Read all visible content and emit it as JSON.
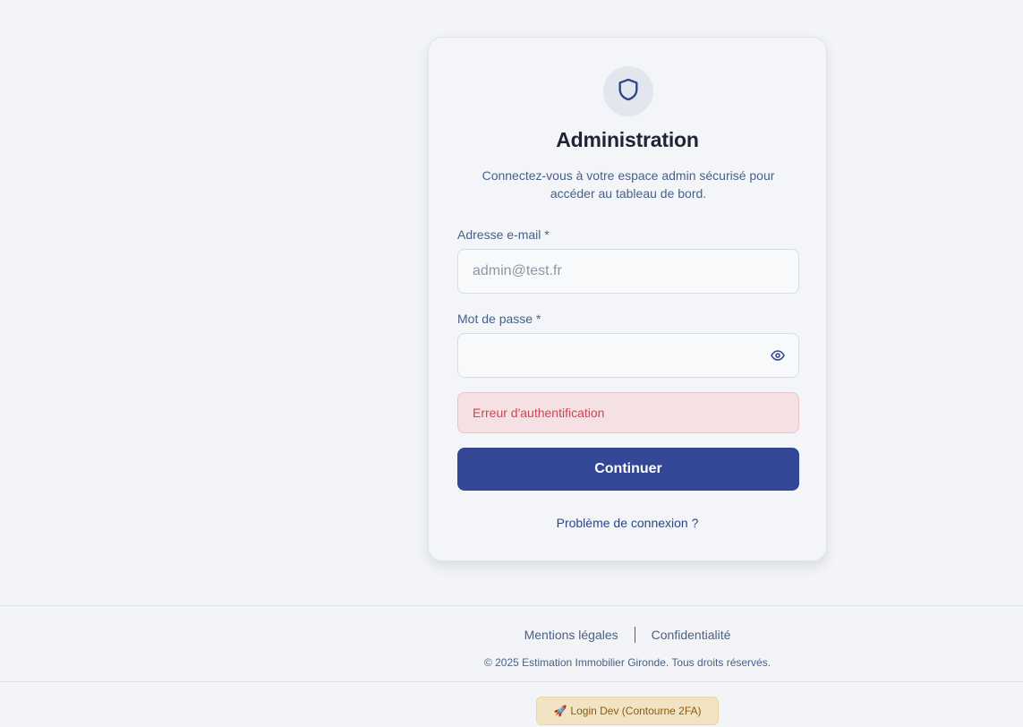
{
  "card": {
    "icon": "shield-icon",
    "title": "Administration",
    "subtitle": "Connectez-vous à votre espace admin sécurisé pour accéder au tableau de bord."
  },
  "form": {
    "email_label": "Adresse e-mail *",
    "email_placeholder": "admin@test.fr",
    "email_value": "",
    "password_label": "Mot de passe *",
    "password_value": "",
    "password_toggle_icon": "eye-icon",
    "error_message": "Erreur d'authentification",
    "submit_label": "Continuer",
    "trouble_link": "Problème de connexion ?"
  },
  "footer": {
    "legal_link": "Mentions légales",
    "privacy_link": "Confidentialité",
    "copyright": "© 2025 Estimation Immobilier Gironde. Tous droits réservés."
  },
  "dev": {
    "icon": "rocket-icon",
    "label": "Login Dev (Contourne 2FA)"
  },
  "colors": {
    "primary": "#334796",
    "error_text": "#d2434f",
    "error_bg": "#f5e1e4",
    "background": "#f2f4f7"
  }
}
